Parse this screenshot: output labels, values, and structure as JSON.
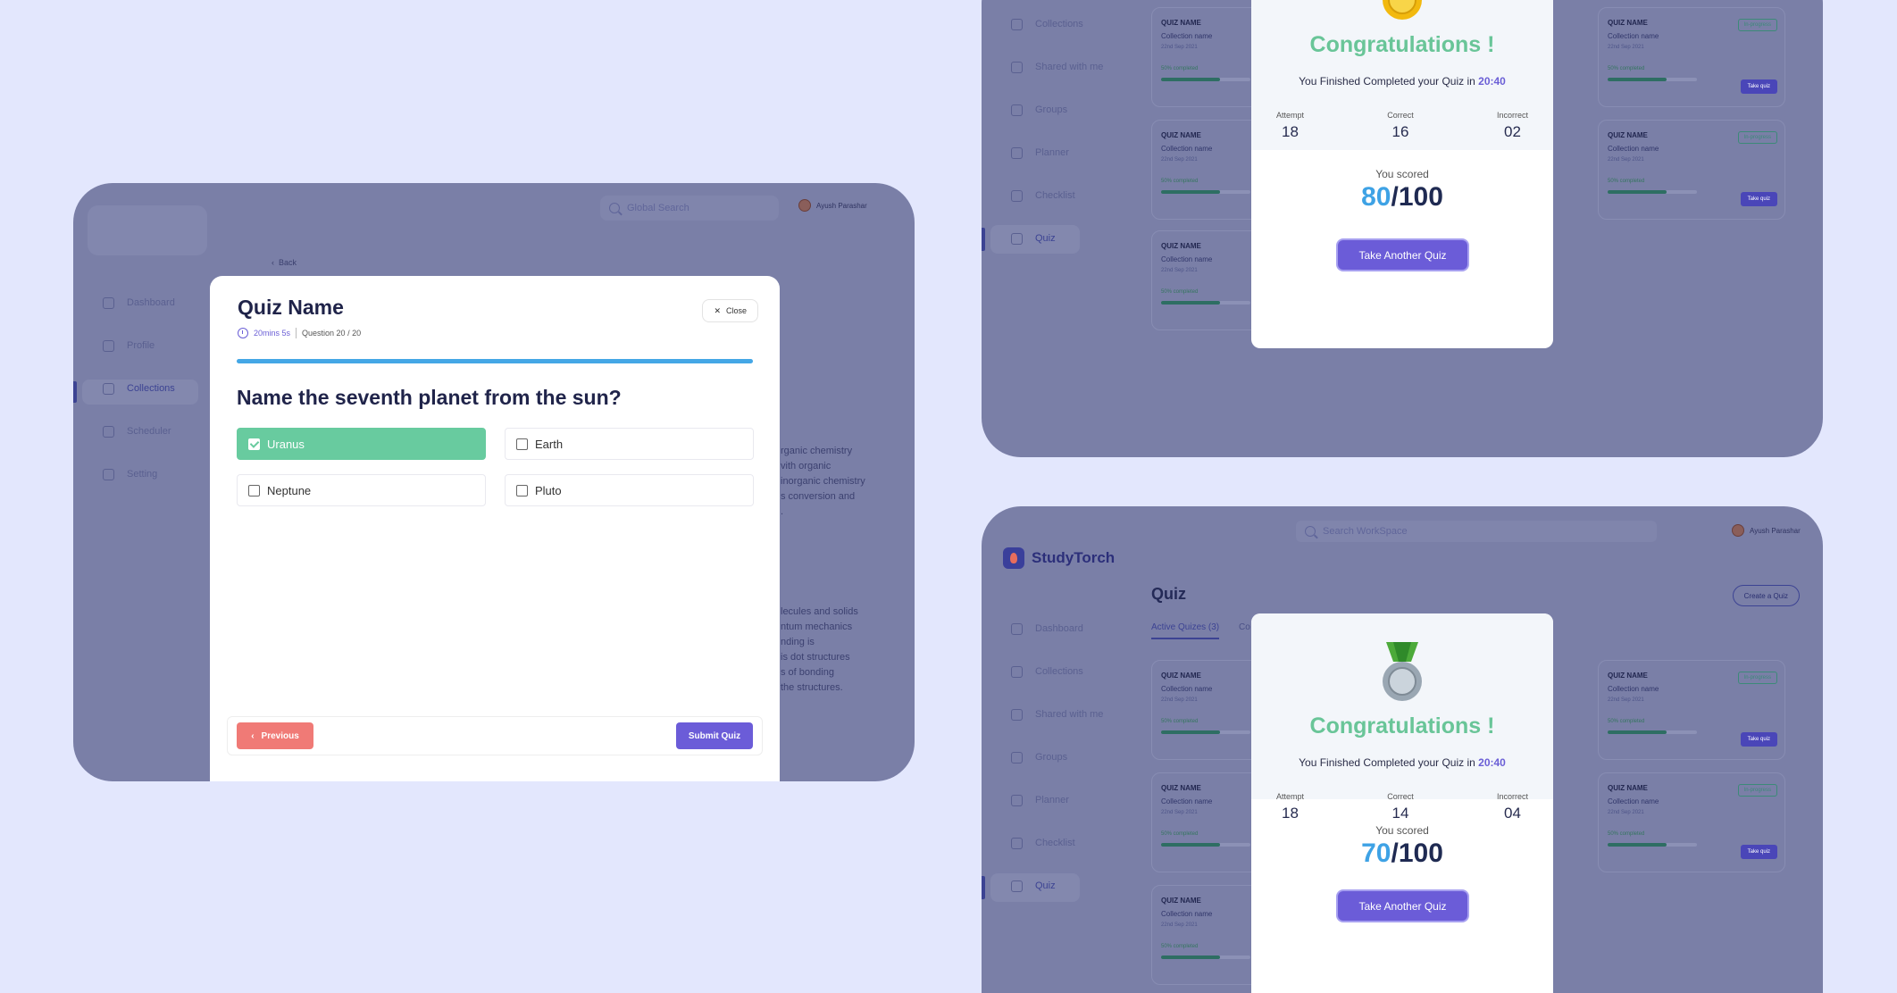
{
  "quiz_screen": {
    "search_placeholder": "Global Search",
    "user_name": "Ayush Parashar",
    "back_label": "Back",
    "sidebar": [
      {
        "label": "Dashboard",
        "icon": "home-icon"
      },
      {
        "label": "Profile",
        "icon": "user-icon"
      },
      {
        "label": "Collections",
        "icon": "folder-icon",
        "active": true
      },
      {
        "label": "Scheduler",
        "icon": "clock-icon"
      },
      {
        "label": "Setting",
        "icon": "gear-icon"
      }
    ],
    "background_text_1": "rganic chemistry\nvith organic\ninorganic chemistry\ns conversion and\n.",
    "background_text_2": "lecules and solids\nntum mechanics\nnding is\nis dot structures\ns of bonding\nthe structures.",
    "modal": {
      "title": "Quiz Name",
      "timer": "20mins 5s",
      "question_counter": "Question 20 / 20",
      "close_label": "Close",
      "progress_fraction": 1.0,
      "question": "Name the seventh planet from the sun?",
      "options": [
        {
          "label": "Uranus",
          "selected": true
        },
        {
          "label": "Earth",
          "selected": false
        },
        {
          "label": "Neptune",
          "selected": false
        },
        {
          "label": "Pluto",
          "selected": false
        }
      ],
      "previous_label": "Previous",
      "submit_label": "Submit Quiz"
    }
  },
  "results": [
    {
      "sidebar": [
        {
          "label": "Collections"
        },
        {
          "label": "Shared with me"
        },
        {
          "label": "Groups"
        },
        {
          "label": "Planner"
        },
        {
          "label": "Checklist"
        },
        {
          "label": "Quiz",
          "active": true
        }
      ],
      "medal": "gold-medal-icon",
      "congrats": "Congratulations !",
      "finished_prefix": "You Finished Completed your Quiz in",
      "finished_time": "20:40",
      "stats": [
        {
          "label": "Attempt",
          "value": "18"
        },
        {
          "label": "Correct",
          "value": "16"
        },
        {
          "label": "Incorrect",
          "value": "02"
        }
      ],
      "scored_label": "You scored",
      "score": "80",
      "score_total": "/100",
      "button": "Take Another Quiz"
    },
    {
      "search_placeholder": "Search WorkSpace",
      "user_name": "Ayush Parashar",
      "brand": "StudyTorch",
      "page_title": "Quiz",
      "create_label": "Create a Quiz",
      "tab_active": "Active Quizes (3)",
      "tab_other": "Co",
      "sidebar": [
        {
          "label": "Dashboard"
        },
        {
          "label": "Collections"
        },
        {
          "label": "Shared with me"
        },
        {
          "label": "Groups"
        },
        {
          "label": "Planner"
        },
        {
          "label": "Checklist"
        },
        {
          "label": "Quiz",
          "active": true
        }
      ],
      "medal": "silver-medal-icon",
      "congrats": "Congratulations !",
      "finished_prefix": "You Finished Completed your Quiz in",
      "finished_time": "20:40",
      "stats": [
        {
          "label": "Attempt",
          "value": "18"
        },
        {
          "label": "Correct",
          "value": "14"
        },
        {
          "label": "Incorrect",
          "value": "04"
        }
      ],
      "scored_label": "You scored",
      "score": "70",
      "score_total": "/100",
      "button": "Take Another Quiz"
    }
  ],
  "quiz_card": {
    "name": "QUIZ NAME",
    "collection": "Collection name",
    "date": "22nd Sep 2021",
    "progress_label": "50% completed",
    "progress_fraction": 0.66,
    "badge": "In-progress",
    "take_label": "Take quiz"
  },
  "colors": {
    "background": "#e3e7fd",
    "overlay": "#7a7fa7",
    "success": "#68cb9f",
    "primary": "#6b5cd8",
    "danger": "#f07a76",
    "score": "#3ea2e5"
  }
}
